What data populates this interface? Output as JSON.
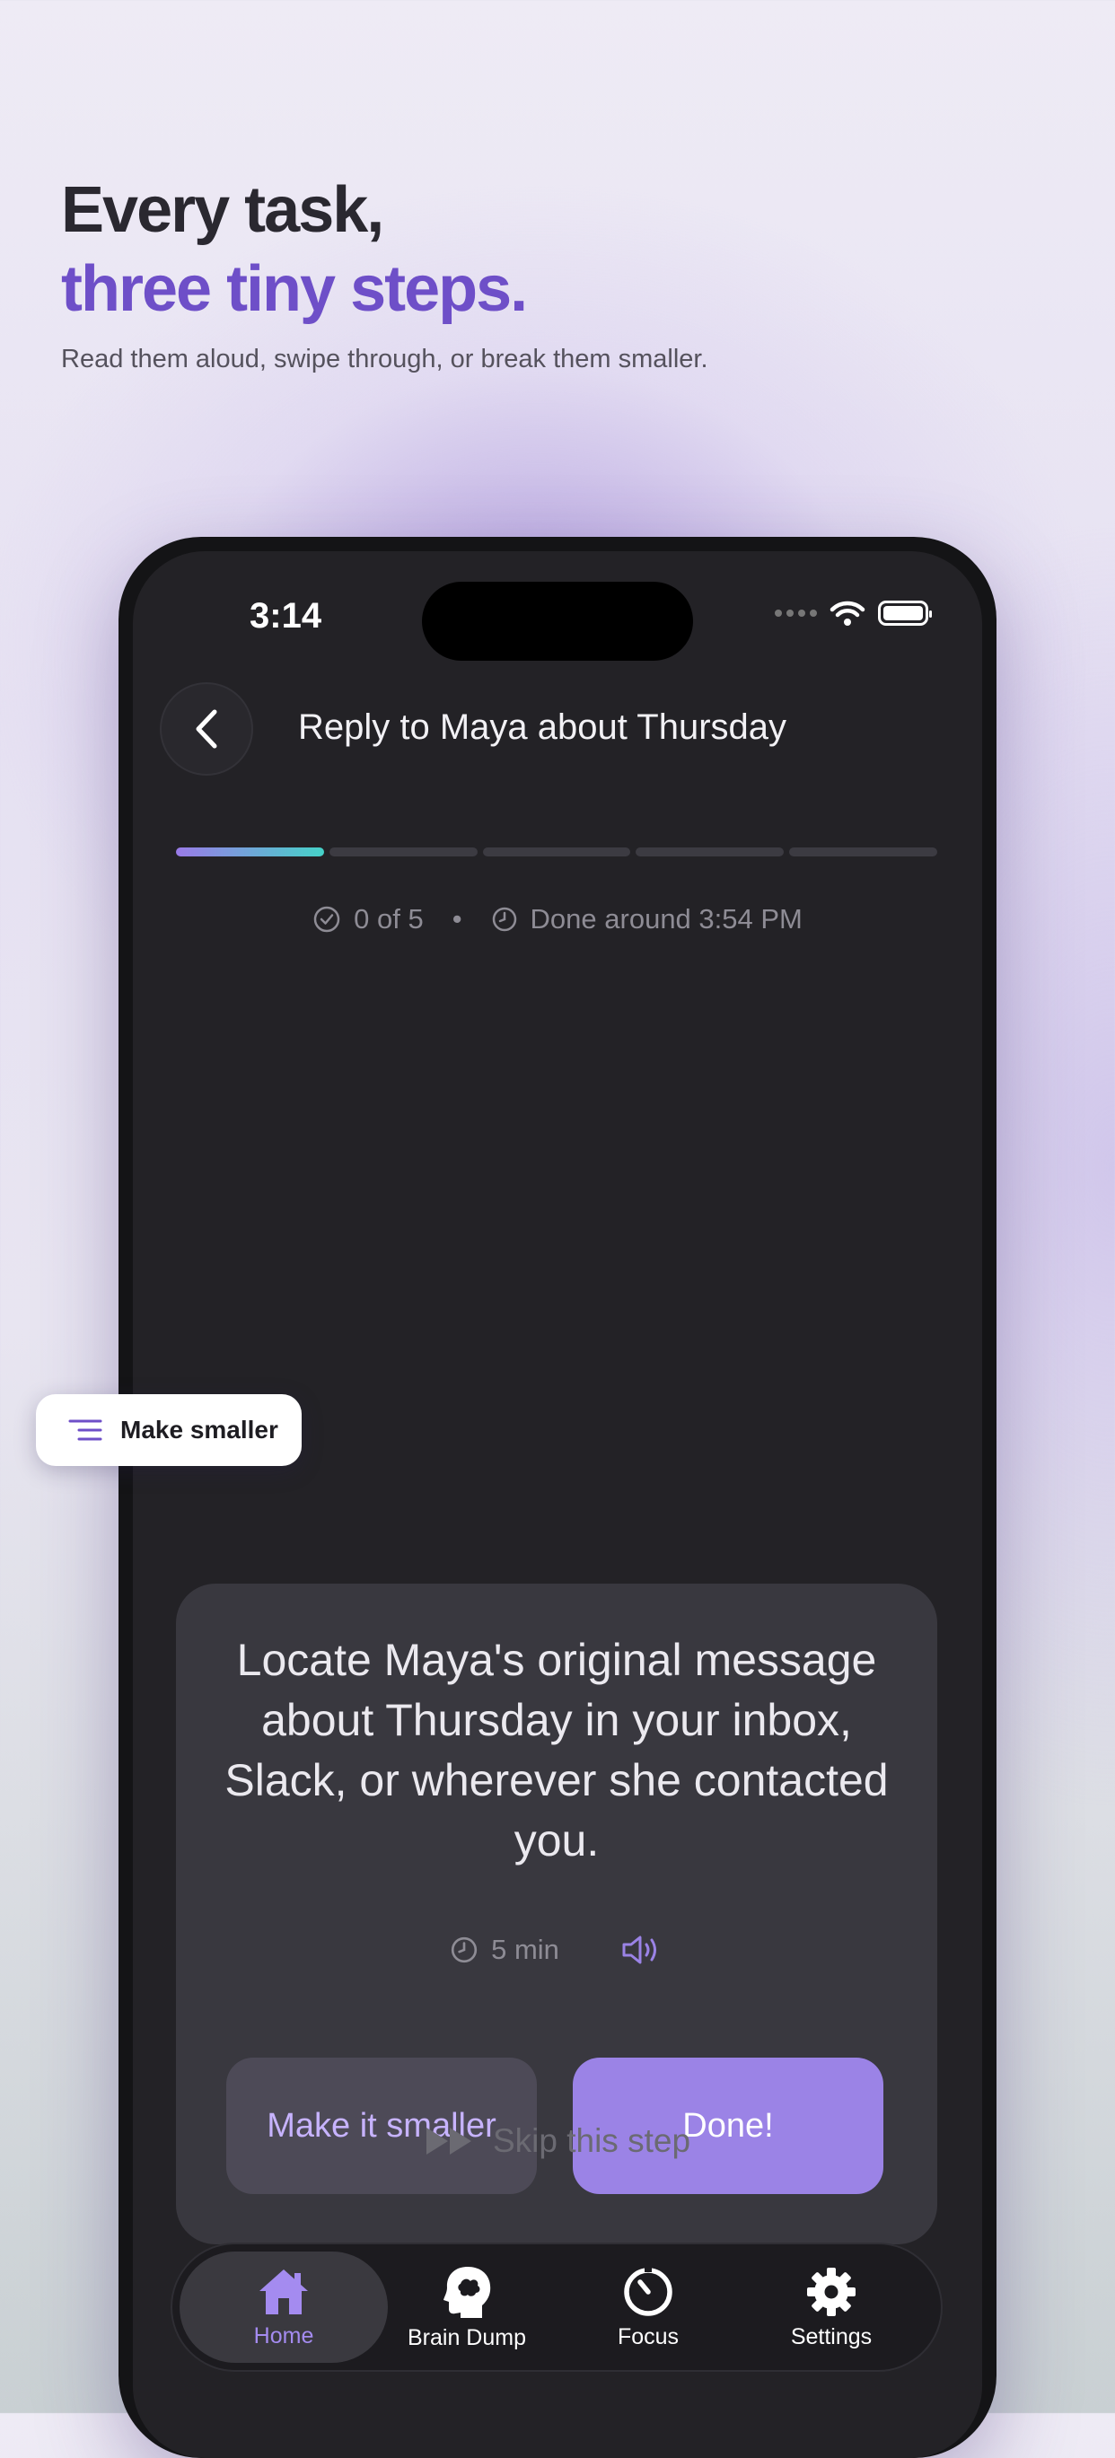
{
  "hero": {
    "line1": "Every task,",
    "line2": "three tiny steps.",
    "subtitle": "Read them aloud, swipe through, or break them smaller."
  },
  "status_bar": {
    "time": "3:14"
  },
  "header": {
    "title": "Reply to Maya about Thursday"
  },
  "progress": {
    "completed_steps": 0,
    "total_steps": 5,
    "count_text": "0 of 5",
    "eta_text": "Done around 3:54 PM"
  },
  "card": {
    "step_text": "Locate Maya's original message about Thursday in your inbox, Slack, or wherever she contacted you.",
    "duration": "5 min",
    "make_smaller_label": "Make it smaller",
    "done_label": "Done!"
  },
  "skip_label": "Skip this step",
  "tabs": [
    {
      "label": "Home",
      "icon": "home-icon",
      "active": true
    },
    {
      "label": "Brain Dump",
      "icon": "brain-head-icon",
      "active": false
    },
    {
      "label": "Focus",
      "icon": "timer-icon",
      "active": false
    },
    {
      "label": "Settings",
      "icon": "gear-icon",
      "active": false
    }
  ],
  "floating_pill": {
    "label": "Make smaller",
    "icon": "list-indent-icon"
  },
  "colors": {
    "accent": "#9b83e6",
    "accent_text": "#6e4fc8",
    "progress_teal": "#45d2c8",
    "screen_bg": "#232226",
    "card_bg": "#39383f"
  }
}
